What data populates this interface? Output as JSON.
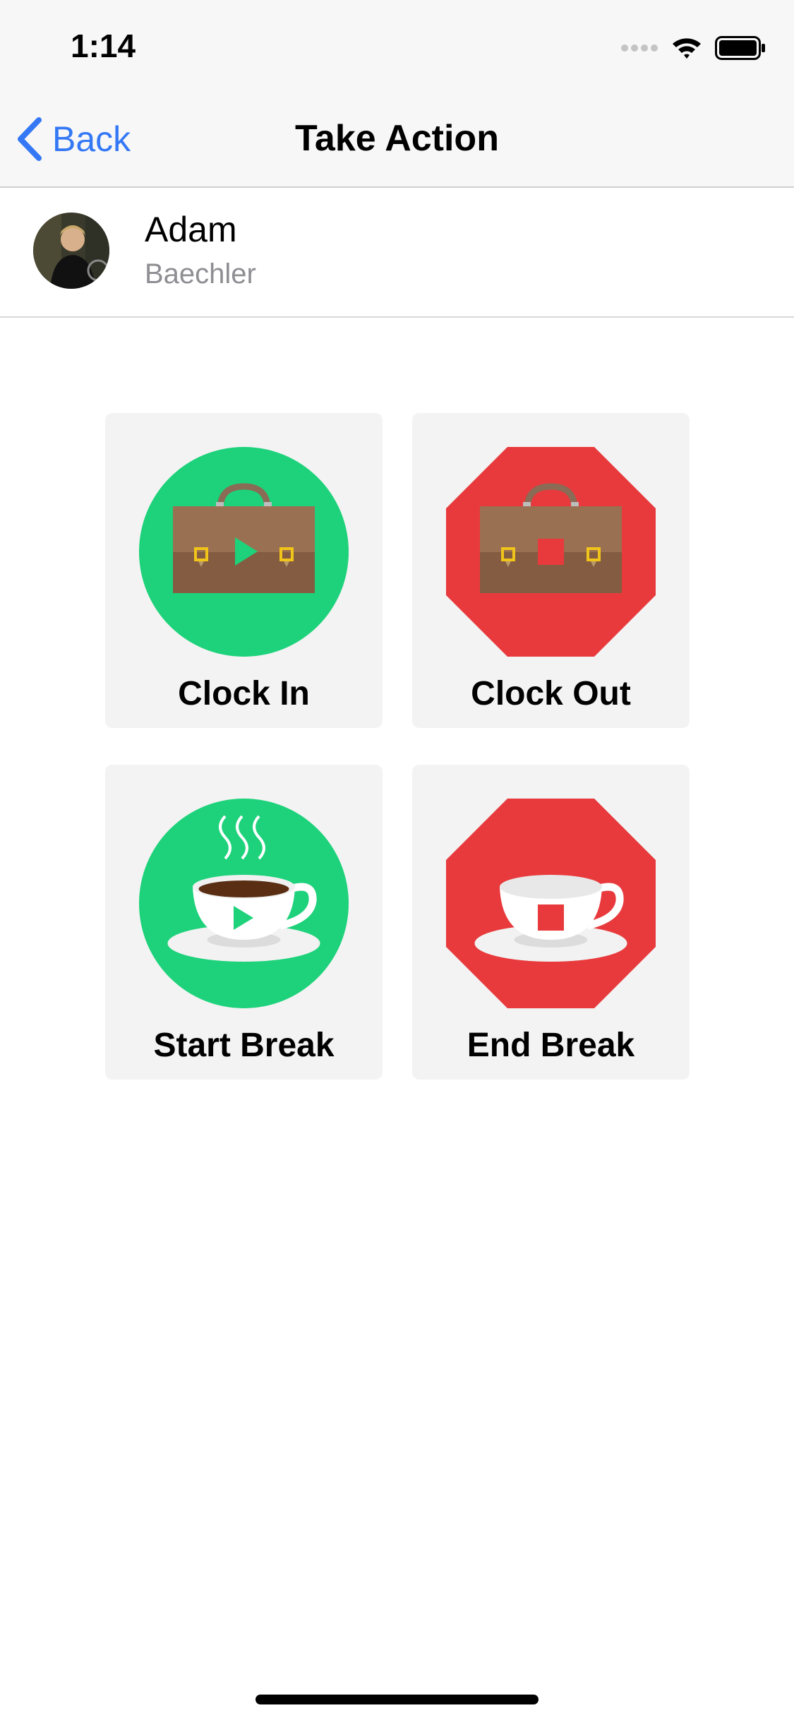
{
  "status_bar": {
    "time": "1:14"
  },
  "nav": {
    "back_label": "Back",
    "title": "Take Action"
  },
  "profile": {
    "first_name": "Adam",
    "last_name": "Baechler"
  },
  "actions": [
    {
      "label": "Clock In",
      "icon": "briefcase-play-icon",
      "shape": "circle",
      "color": "#1dd27a"
    },
    {
      "label": "Clock Out",
      "icon": "briefcase-stop-icon",
      "shape": "octagon",
      "color": "#e83a3c"
    },
    {
      "label": "Start Break",
      "icon": "coffee-play-icon",
      "shape": "circle",
      "color": "#1dd27a"
    },
    {
      "label": "End Break",
      "icon": "coffee-stop-icon",
      "shape": "octagon",
      "color": "#e83a3c"
    }
  ],
  "colors": {
    "accent": "#3478f6",
    "green": "#1dd27a",
    "red": "#e83a3c",
    "tile_bg": "#f3f3f3"
  }
}
